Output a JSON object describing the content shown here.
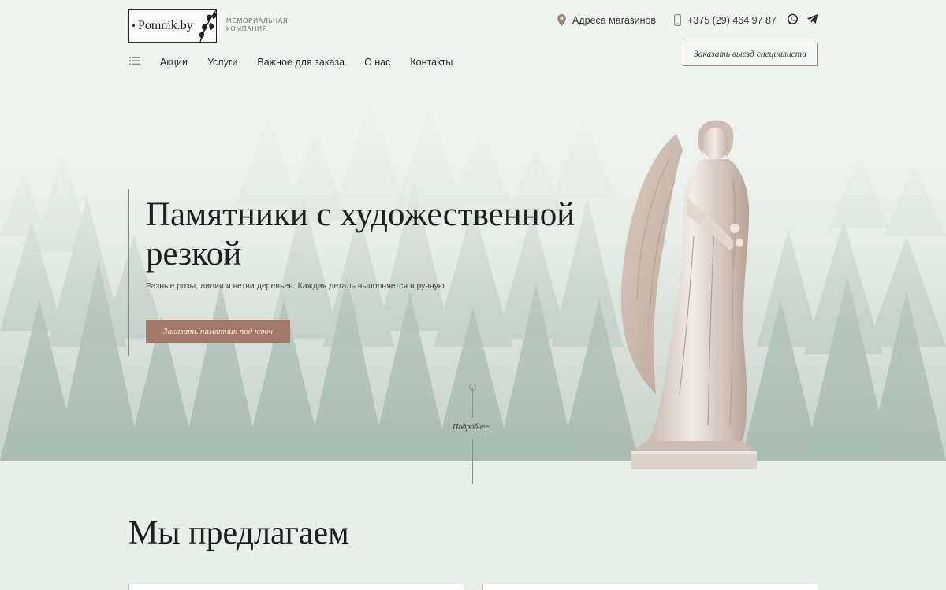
{
  "header": {
    "logo_text": "Pomnik.by",
    "tagline_line1": "Мемориальная",
    "tagline_line2": "компания",
    "address_label": "Адреса магазинов",
    "phone": "+375 (29) 464 97 87",
    "cta_label": "Заказать выезд специалиста"
  },
  "nav": {
    "items": [
      {
        "label": "Акции"
      },
      {
        "label": "Услуги"
      },
      {
        "label": "Важное для заказа"
      },
      {
        "label": "О нас"
      },
      {
        "label": "Контакты"
      }
    ]
  },
  "hero": {
    "title": "Памятники с художественной резкой",
    "subtitle": "Разные розы, лилии и ветви деревьев. Каждая деталь выполняется в ручную.",
    "button_label": "Заказать памятник под ключ",
    "scroll_label": "Подробнее"
  },
  "offer": {
    "title": "Мы предлагаем"
  },
  "icons": [
    "logo-leaf-icon",
    "map-pin-icon",
    "phone-icon",
    "whatsapp-icon",
    "telegram-icon",
    "menu-icon"
  ],
  "colors": {
    "accent": "#a2786a",
    "outline": "#a58d7e",
    "text": "#1f1f1f"
  }
}
